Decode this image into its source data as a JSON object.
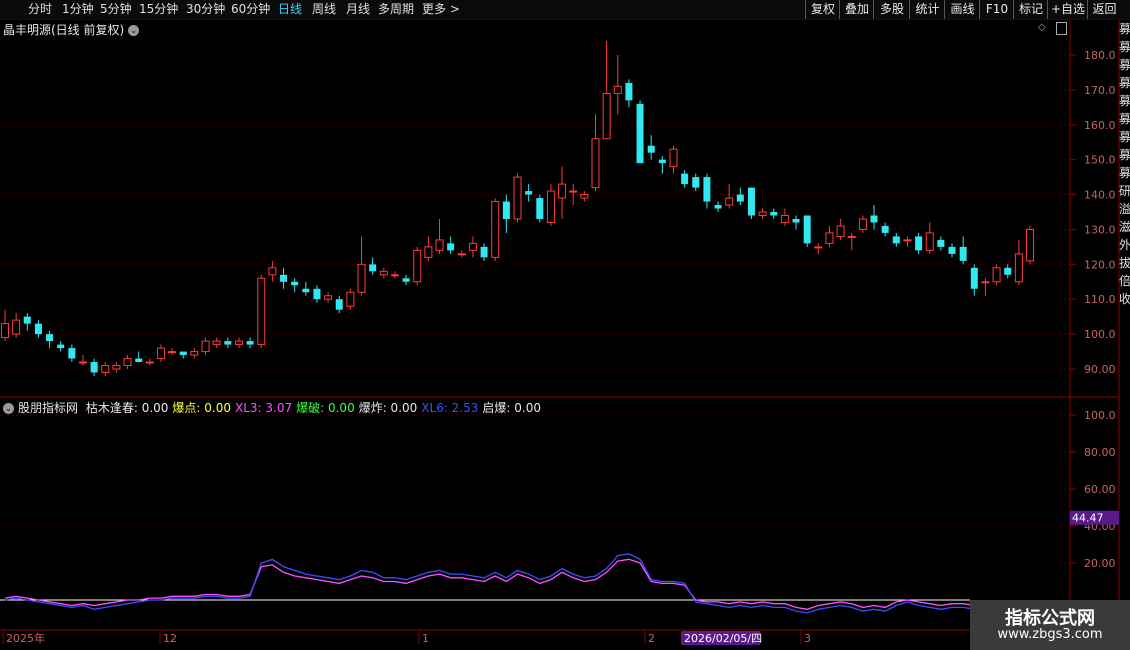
{
  "topbar": {
    "periods": [
      {
        "label": "分时"
      },
      {
        "label": "1分钟"
      },
      {
        "label": "5分钟"
      },
      {
        "label": "15分钟"
      },
      {
        "label": "30分钟"
      },
      {
        "label": "60分钟"
      },
      {
        "label": "日线",
        "active": true
      },
      {
        "label": "周线"
      },
      {
        "label": "月线"
      },
      {
        "label": "多周期"
      },
      {
        "label": "更多 >"
      }
    ],
    "tools": [
      "复权",
      "叠加",
      "多股",
      "统计",
      "画线",
      "F10",
      "标记",
      "+自选",
      "返回"
    ]
  },
  "main": {
    "title": "晶丰明源(日线 前复权)",
    "title_icon": "chevron-down-icon",
    "ticks": [
      "180.0",
      "170.0",
      "160.0",
      "150.0",
      "140.0",
      "130.0",
      "120.0",
      "110.0",
      "100.0",
      "90.00"
    ]
  },
  "indicator": {
    "name": "股朋指标网",
    "icon": "chevron-down-icon",
    "items": [
      {
        "label": "枯木逢春: 0.00",
        "color": "#e8e8e8"
      },
      {
        "label": "爆点: 0.00",
        "color": "#ffff3a"
      },
      {
        "label": "XL3: 3.07",
        "color": "#ff50ff"
      },
      {
        "label": "爆破: 0.00",
        "color": "#40ff40"
      },
      {
        "label": "爆炸: 0.00",
        "color": "#e8e8e8"
      },
      {
        "label": "XL6: 2.53",
        "color": "#3a50ff"
      },
      {
        "label": "启爆: 0.00",
        "color": "#e8e8e8"
      }
    ],
    "ticks": [
      "100.0",
      "80.00",
      "60.00",
      "40.00",
      "20.00"
    ],
    "current_label": "44.47",
    "accent_color": "#5a1a8a"
  },
  "date_axis": {
    "labels": [
      "2025年",
      "12",
      "1",
      "2",
      "3"
    ],
    "highlight": "2026/02/05/四"
  },
  "right_strip": [
    "募",
    "募",
    "募",
    "募",
    "募",
    "募",
    "募",
    "募",
    "募",
    "研",
    "溢",
    "滋",
    "外",
    "拔",
    "倍",
    "收"
  ],
  "watermark": {
    "line1": "指标公式网",
    "line2": "www.zbgs3.com"
  },
  "colors": {
    "up": "#ff3a3a",
    "down": "#30e8f0",
    "grid": "#4a0000",
    "axis": "#c0c0c0"
  },
  "chart_data": {
    "type": "candlestick",
    "ylim": [
      85,
      185
    ],
    "candles": [
      {
        "o": 99,
        "c": 103,
        "h": 107,
        "l": 98
      },
      {
        "o": 100,
        "c": 104,
        "h": 106,
        "l": 99
      },
      {
        "o": 105,
        "c": 103,
        "h": 106,
        "l": 101
      },
      {
        "o": 103,
        "c": 100,
        "h": 104,
        "l": 99
      },
      {
        "o": 100,
        "c": 98,
        "h": 101,
        "l": 96
      },
      {
        "o": 97,
        "c": 96,
        "h": 98,
        "l": 95
      },
      {
        "o": 96,
        "c": 93,
        "h": 97,
        "l": 92
      },
      {
        "o": 92,
        "c": 92,
        "h": 94,
        "l": 91
      },
      {
        "o": 92,
        "c": 89,
        "h": 93,
        "l": 88
      },
      {
        "o": 89,
        "c": 91,
        "h": 92,
        "l": 88
      },
      {
        "o": 90,
        "c": 91,
        "h": 92,
        "l": 89
      },
      {
        "o": 91,
        "c": 93,
        "h": 94,
        "l": 90
      },
      {
        "o": 93,
        "c": 92,
        "h": 95,
        "l": 92
      },
      {
        "o": 92,
        "c": 92,
        "h": 93,
        "l": 91
      },
      {
        "o": 93,
        "c": 96,
        "h": 97,
        "l": 92
      },
      {
        "o": 95,
        "c": 95,
        "h": 96,
        "l": 94
      },
      {
        "o": 95,
        "c": 94,
        "h": 95,
        "l": 93
      },
      {
        "o": 94,
        "c": 95,
        "h": 96,
        "l": 93
      },
      {
        "o": 95,
        "c": 98,
        "h": 99,
        "l": 94
      },
      {
        "o": 97,
        "c": 98,
        "h": 99,
        "l": 96
      },
      {
        "o": 98,
        "c": 97,
        "h": 99,
        "l": 96
      },
      {
        "o": 97,
        "c": 98,
        "h": 99,
        "l": 96
      },
      {
        "o": 98,
        "c": 97,
        "h": 99,
        "l": 96
      },
      {
        "o": 97,
        "c": 116,
        "h": 117,
        "l": 96
      },
      {
        "o": 117,
        "c": 119,
        "h": 121,
        "l": 115
      },
      {
        "o": 117,
        "c": 115,
        "h": 119,
        "l": 113
      },
      {
        "o": 115,
        "c": 114,
        "h": 116,
        "l": 112
      },
      {
        "o": 113,
        "c": 112,
        "h": 115,
        "l": 111
      },
      {
        "o": 113,
        "c": 110,
        "h": 114,
        "l": 109
      },
      {
        "o": 110,
        "c": 111,
        "h": 112,
        "l": 109
      },
      {
        "o": 110,
        "c": 107,
        "h": 111,
        "l": 106
      },
      {
        "o": 108,
        "c": 112,
        "h": 113,
        "l": 107
      },
      {
        "o": 112,
        "c": 120,
        "h": 128,
        "l": 111
      },
      {
        "o": 120,
        "c": 118,
        "h": 122,
        "l": 117
      },
      {
        "o": 117,
        "c": 118,
        "h": 119,
        "l": 116
      },
      {
        "o": 117,
        "c": 117,
        "h": 118,
        "l": 116
      },
      {
        "o": 116,
        "c": 115,
        "h": 117,
        "l": 114
      },
      {
        "o": 115,
        "c": 124,
        "h": 125,
        "l": 114
      },
      {
        "o": 122,
        "c": 125,
        "h": 128,
        "l": 121
      },
      {
        "o": 124,
        "c": 127,
        "h": 133,
        "l": 123
      },
      {
        "o": 126,
        "c": 124,
        "h": 128,
        "l": 123
      },
      {
        "o": 123,
        "c": 123,
        "h": 124,
        "l": 122
      },
      {
        "o": 124,
        "c": 126,
        "h": 128,
        "l": 122
      },
      {
        "o": 125,
        "c": 122,
        "h": 126,
        "l": 121
      },
      {
        "o": 122,
        "c": 138,
        "h": 139,
        "l": 121
      },
      {
        "o": 138,
        "c": 133,
        "h": 140,
        "l": 129
      },
      {
        "o": 133,
        "c": 145,
        "h": 146,
        "l": 132
      },
      {
        "o": 141,
        "c": 140,
        "h": 143,
        "l": 138
      },
      {
        "o": 139,
        "c": 133,
        "h": 140,
        "l": 132
      },
      {
        "o": 132,
        "c": 141,
        "h": 143,
        "l": 131
      },
      {
        "o": 139,
        "c": 143,
        "h": 148,
        "l": 133
      },
      {
        "o": 141,
        "c": 141,
        "h": 143,
        "l": 137
      },
      {
        "o": 139,
        "c": 140,
        "h": 141,
        "l": 138
      },
      {
        "o": 142,
        "c": 156,
        "h": 163,
        "l": 141
      },
      {
        "o": 156,
        "c": 169,
        "h": 184,
        "l": 156
      },
      {
        "o": 169,
        "c": 171,
        "h": 180,
        "l": 163
      },
      {
        "o": 172,
        "c": 167,
        "h": 173,
        "l": 165
      },
      {
        "o": 166,
        "c": 149,
        "h": 167,
        "l": 149
      },
      {
        "o": 154,
        "c": 152,
        "h": 157,
        "l": 150
      },
      {
        "o": 150,
        "c": 149,
        "h": 151,
        "l": 146
      },
      {
        "o": 148,
        "c": 153,
        "h": 154,
        "l": 146
      },
      {
        "o": 146,
        "c": 143,
        "h": 147,
        "l": 142
      },
      {
        "o": 145,
        "c": 142,
        "h": 146,
        "l": 141
      },
      {
        "o": 145,
        "c": 138,
        "h": 146,
        "l": 136
      },
      {
        "o": 137,
        "c": 136,
        "h": 138,
        "l": 135
      },
      {
        "o": 137,
        "c": 139,
        "h": 143,
        "l": 136
      },
      {
        "o": 140,
        "c": 138,
        "h": 142,
        "l": 137
      },
      {
        "o": 142,
        "c": 134,
        "h": 142,
        "l": 133
      },
      {
        "o": 134,
        "c": 135,
        "h": 136,
        "l": 133
      },
      {
        "o": 135,
        "c": 134,
        "h": 136,
        "l": 133
      },
      {
        "o": 132,
        "c": 134,
        "h": 136,
        "l": 131
      },
      {
        "o": 133,
        "c": 132,
        "h": 134,
        "l": 130
      },
      {
        "o": 134,
        "c": 126,
        "h": 134,
        "l": 125
      },
      {
        "o": 125,
        "c": 125,
        "h": 126,
        "l": 123
      },
      {
        "o": 126,
        "c": 129,
        "h": 131,
        "l": 125
      },
      {
        "o": 128,
        "c": 131,
        "h": 133,
        "l": 127
      },
      {
        "o": 128,
        "c": 128,
        "h": 129,
        "l": 124
      },
      {
        "o": 130,
        "c": 133,
        "h": 134,
        "l": 129
      },
      {
        "o": 134,
        "c": 132,
        "h": 137,
        "l": 130
      },
      {
        "o": 131,
        "c": 129,
        "h": 132,
        "l": 128
      },
      {
        "o": 128,
        "c": 126,
        "h": 129,
        "l": 125
      },
      {
        "o": 127,
        "c": 127,
        "h": 128,
        "l": 125
      },
      {
        "o": 128,
        "c": 124,
        "h": 129,
        "l": 123
      },
      {
        "o": 124,
        "c": 129,
        "h": 132,
        "l": 123
      },
      {
        "o": 127,
        "c": 125,
        "h": 128,
        "l": 124
      },
      {
        "o": 125,
        "c": 123,
        "h": 126,
        "l": 122
      },
      {
        "o": 125,
        "c": 121,
        "h": 128,
        "l": 120
      },
      {
        "o": 119,
        "c": 113,
        "h": 120,
        "l": 111
      },
      {
        "o": 115,
        "c": 115,
        "h": 116,
        "l": 111
      },
      {
        "o": 115,
        "c": 119,
        "h": 120,
        "l": 114
      },
      {
        "o": 119,
        "c": 117,
        "h": 120,
        "l": 116
      },
      {
        "o": 115,
        "c": 123,
        "h": 127,
        "l": 114
      },
      {
        "o": 121,
        "c": 130,
        "h": 131,
        "l": 120
      }
    ],
    "indicator_series": [
      {
        "name": "XL3",
        "color": "#ff50ff",
        "values": [
          1,
          2,
          1,
          0,
          -1,
          -2,
          -3,
          -2,
          -3,
          -2,
          -1,
          0,
          0,
          1,
          1,
          2,
          2,
          2,
          3,
          3,
          2,
          2,
          3,
          18,
          19,
          15,
          13,
          12,
          11,
          10,
          9,
          11,
          13,
          12,
          10,
          10,
          9,
          11,
          13,
          14,
          12,
          12,
          11,
          10,
          13,
          10,
          14,
          12,
          9,
          11,
          15,
          12,
          10,
          11,
          15,
          21,
          22,
          20,
          10,
          9,
          9,
          8,
          0,
          -1,
          -1,
          -2,
          -1,
          -2,
          -1,
          -2,
          -2,
          -4,
          -5,
          -3,
          -2,
          -1,
          -2,
          -4,
          -3,
          -4,
          -1,
          0,
          -1,
          -2,
          -3,
          -2,
          -2,
          -3,
          -5,
          -4,
          -6,
          -7,
          -6,
          -4,
          -3
        ]
      },
      {
        "name": "XL6",
        "color": "#3a50ff",
        "values": [
          0,
          1,
          0,
          -1,
          -2,
          -3,
          -4,
          -3,
          -5,
          -4,
          -3,
          -2,
          -1,
          0,
          0,
          1,
          1,
          1,
          2,
          2,
          1,
          1,
          2,
          20,
          22,
          18,
          16,
          14,
          13,
          12,
          11,
          13,
          16,
          15,
          12,
          12,
          11,
          13,
          15,
          16,
          14,
          14,
          13,
          12,
          15,
          12,
          16,
          14,
          11,
          13,
          17,
          14,
          12,
          13,
          17,
          24,
          25,
          22,
          11,
          10,
          10,
          9,
          -1,
          -2,
          -3,
          -4,
          -3,
          -4,
          -3,
          -4,
          -4,
          -6,
          -7,
          -5,
          -4,
          -3,
          -4,
          -6,
          -5,
          -6,
          -3,
          -1,
          -3,
          -4,
          -5,
          -4,
          -4,
          -5,
          -7,
          -6,
          -8,
          -9,
          -8,
          -6,
          -4
        ]
      }
    ],
    "indicator_ylim": [
      -10,
      110
    ]
  }
}
